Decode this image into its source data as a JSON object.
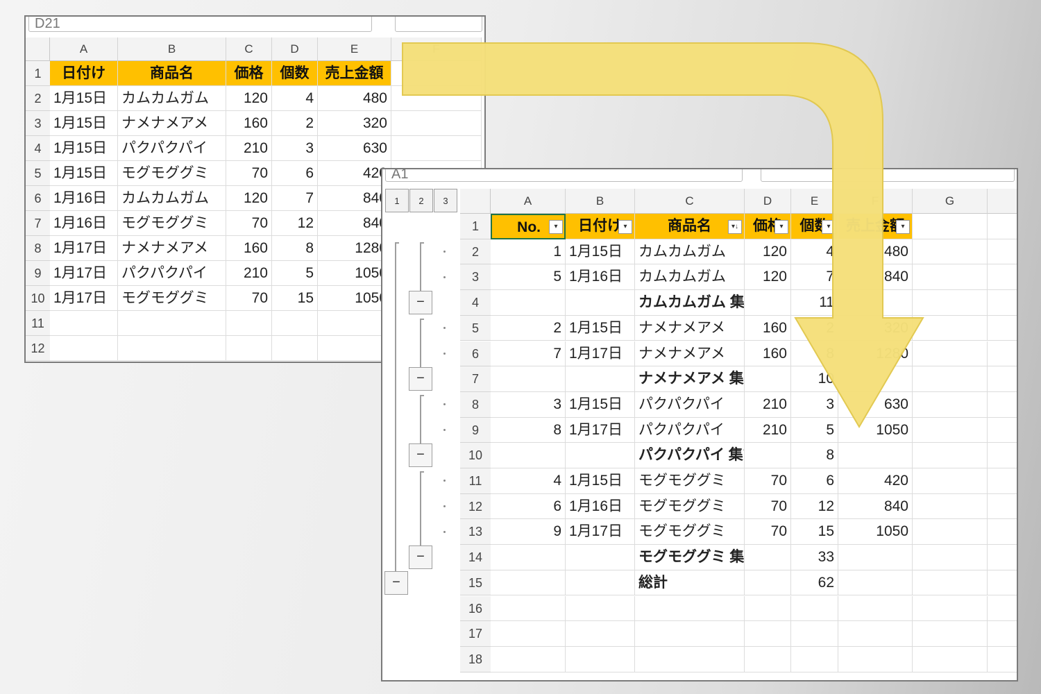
{
  "colors": {
    "header_fill": "#ffc000",
    "arrow": "#f5e07a",
    "arrow_border": "#e2c84d"
  },
  "back_sheet": {
    "name_box": "D21",
    "col_headers": [
      "A",
      "B",
      "C",
      "D",
      "E",
      "F"
    ],
    "row_headers": [
      "1",
      "2",
      "3",
      "4",
      "5",
      "6",
      "7",
      "8",
      "9",
      "10",
      "11",
      "12"
    ],
    "header_row": [
      "日付け",
      "商品名",
      "価格",
      "個数",
      "売上金額"
    ],
    "rows": [
      [
        "1月15日",
        "カムカムガム",
        "120",
        "4",
        "480"
      ],
      [
        "1月15日",
        "ナメナメアメ",
        "160",
        "2",
        "320"
      ],
      [
        "1月15日",
        "パクパクパイ",
        "210",
        "3",
        "630"
      ],
      [
        "1月15日",
        "モグモググミ",
        "70",
        "6",
        "420"
      ],
      [
        "1月16日",
        "カムカムガム",
        "120",
        "7",
        "840"
      ],
      [
        "1月16日",
        "モグモググミ",
        "70",
        "12",
        "840"
      ],
      [
        "1月17日",
        "ナメナメアメ",
        "160",
        "8",
        "1280"
      ],
      [
        "1月17日",
        "パクパクパイ",
        "210",
        "5",
        "1050"
      ],
      [
        "1月17日",
        "モグモググミ",
        "70",
        "15",
        "1050"
      ]
    ]
  },
  "front_sheet": {
    "name_box": "A1",
    "outline_levels": [
      "1",
      "2",
      "3"
    ],
    "collapse_symbol": "−",
    "col_headers": [
      "A",
      "B",
      "C",
      "D",
      "E",
      "F",
      "G"
    ],
    "row_headers": [
      "1",
      "2",
      "3",
      "4",
      "5",
      "6",
      "7",
      "8",
      "9",
      "10",
      "11",
      "12",
      "13",
      "14",
      "15",
      "16",
      "17",
      "18"
    ],
    "header_row": [
      "No.",
      "日付け",
      "商品名",
      "価格",
      "個数",
      "売上金額"
    ],
    "rows": [
      [
        "1",
        "1月15日",
        "カムカムガム",
        "120",
        "4",
        "480"
      ],
      [
        "5",
        "1月16日",
        "カムカムガム",
        "120",
        "7",
        "840"
      ],
      [
        "",
        "",
        "カムカムガム 集計",
        "",
        "11",
        ""
      ],
      [
        "2",
        "1月15日",
        "ナメナメアメ",
        "160",
        "2",
        "320"
      ],
      [
        "7",
        "1月17日",
        "ナメナメアメ",
        "160",
        "8",
        "1280"
      ],
      [
        "",
        "",
        "ナメナメアメ 集計",
        "",
        "10",
        ""
      ],
      [
        "3",
        "1月15日",
        "パクパクパイ",
        "210",
        "3",
        "630"
      ],
      [
        "8",
        "1月17日",
        "パクパクパイ",
        "210",
        "5",
        "1050"
      ],
      [
        "",
        "",
        "パクパクパイ 集計",
        "",
        "8",
        ""
      ],
      [
        "4",
        "1月15日",
        "モグモググミ",
        "70",
        "6",
        "420"
      ],
      [
        "6",
        "1月16日",
        "モグモググミ",
        "70",
        "12",
        "840"
      ],
      [
        "9",
        "1月17日",
        "モグモググミ",
        "70",
        "15",
        "1050"
      ],
      [
        "",
        "",
        "モグモググミ 集計",
        "",
        "33",
        ""
      ],
      [
        "",
        "",
        "総計",
        "",
        "62",
        ""
      ]
    ]
  }
}
